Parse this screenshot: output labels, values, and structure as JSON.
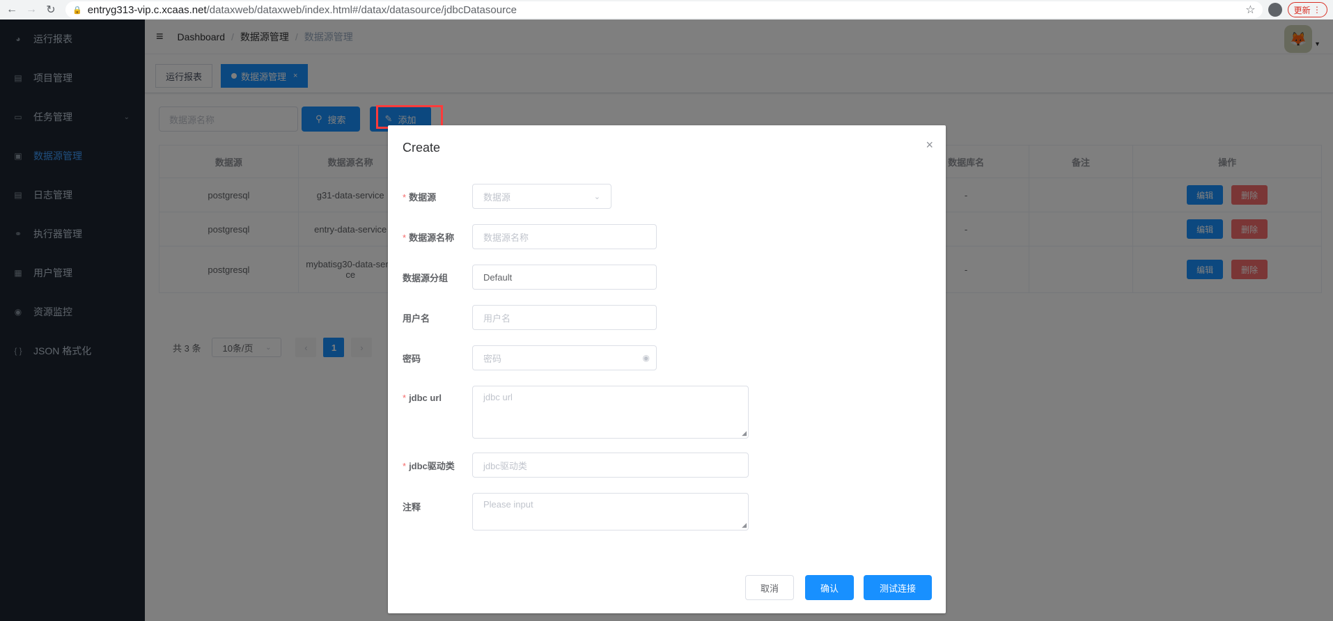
{
  "browser": {
    "url_host": "entryg313-vip.c.xcaas.net",
    "url_path": "/dataxweb/dataxweb/index.html#/datax/datasource/jdbcDatasource",
    "update_label": "更新"
  },
  "sidebar": {
    "items": [
      {
        "label": "运行报表",
        "icon": "dashboard-icon"
      },
      {
        "label": "项目管理",
        "icon": "project-icon"
      },
      {
        "label": "任务管理",
        "icon": "task-icon"
      },
      {
        "label": "数据源管理",
        "icon": "database-icon"
      },
      {
        "label": "日志管理",
        "icon": "log-icon"
      },
      {
        "label": "执行器管理",
        "icon": "executor-icon"
      },
      {
        "label": "用户管理",
        "icon": "user-icon"
      },
      {
        "label": "资源监控",
        "icon": "monitor-icon"
      },
      {
        "label": "JSON 格式化",
        "icon": "json-icon"
      }
    ]
  },
  "header": {
    "breadcrumb": [
      "Dashboard",
      "数据源管理",
      "数据源管理"
    ]
  },
  "tags": [
    {
      "label": "运行报表"
    },
    {
      "label": "数据源管理"
    }
  ],
  "toolbar": {
    "search_placeholder": "数据源名称",
    "search_label": "搜索",
    "add_label": "添加"
  },
  "table": {
    "headers": [
      "数据源",
      "数据源名称",
      "数据库名",
      "备注",
      "操作"
    ],
    "rows": [
      {
        "source": "postgresql",
        "name": "g31-data-service",
        "db": "-",
        "note": ""
      },
      {
        "source": "postgresql",
        "name": "entry-data-service",
        "db": "-",
        "note": ""
      },
      {
        "source": "postgresql",
        "name": "mybatisg30-data-service",
        "db": "-",
        "note": ""
      }
    ],
    "edit_label": "编辑",
    "delete_label": "删除"
  },
  "pagination": {
    "total": "共 3 条",
    "page_size": "10条/页",
    "current_page": "1"
  },
  "dialog": {
    "title": "Create",
    "fields": {
      "datasource": {
        "label": "数据源",
        "placeholder": "数据源"
      },
      "name": {
        "label": "数据源名称",
        "placeholder": "数据源名称"
      },
      "group": {
        "label": "数据源分组",
        "value": "Default"
      },
      "username": {
        "label": "用户名",
        "placeholder": "用户名"
      },
      "password": {
        "label": "密码",
        "placeholder": "密码"
      },
      "jdbc_url": {
        "label": "jdbc url",
        "placeholder": "jdbc url"
      },
      "jdbc_driver": {
        "label": "jdbc驱动类",
        "placeholder": "jdbc驱动类"
      },
      "comment": {
        "label": "注释",
        "placeholder": "Please input"
      }
    },
    "cancel_label": "取消",
    "confirm_label": "确认",
    "test_label": "测试连接"
  },
  "colors": {
    "sidebar_bg": "#1d2530",
    "primary": "#1890ff",
    "danger": "#f56c6c",
    "annotation": "#ff3b3b"
  }
}
